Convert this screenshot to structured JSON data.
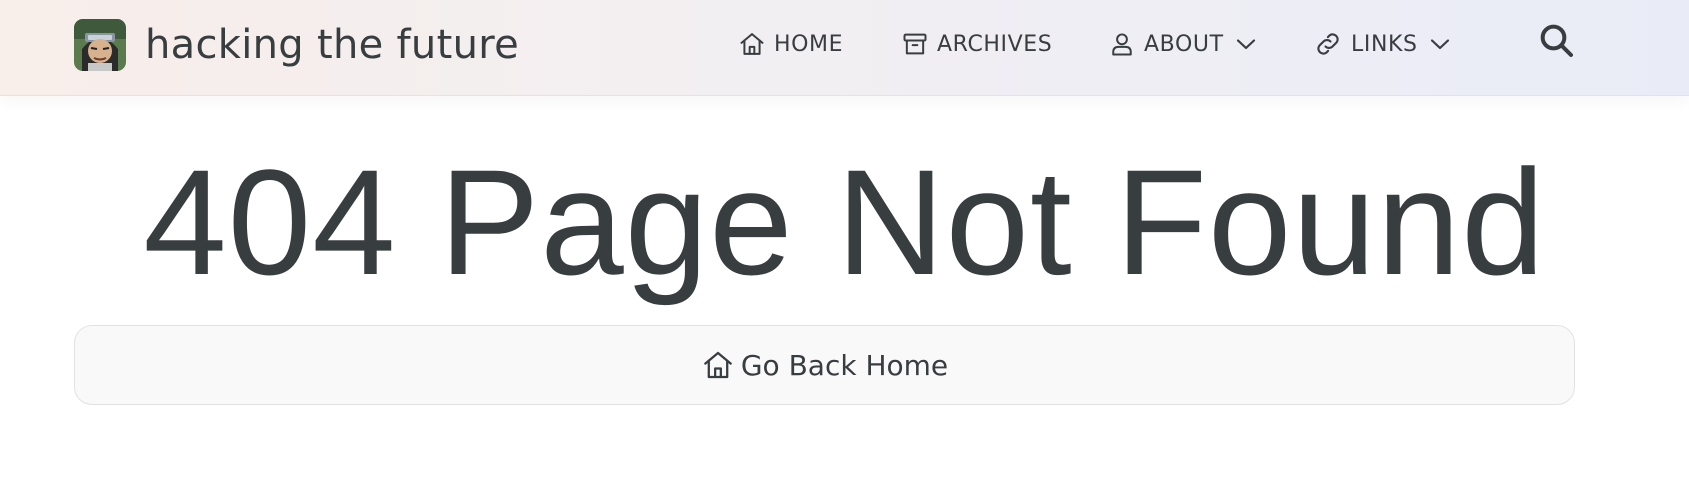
{
  "header": {
    "site_title": "hacking the future",
    "avatar_icon": "anime-avatar-icon",
    "nav": [
      {
        "label": "HOME",
        "icon": "home-icon"
      },
      {
        "label": "ARCHIVES",
        "icon": "archive-icon"
      },
      {
        "label": "ABOUT",
        "icon": "user-icon",
        "has_dropdown": true
      },
      {
        "label": "LINKS",
        "icon": "link-icon",
        "has_dropdown": true
      }
    ],
    "search_icon": "search-icon"
  },
  "main": {
    "headline": "404 Page Not Found",
    "back_button_label": "Go Back Home",
    "back_button_icon": "home-icon"
  },
  "colors": {
    "text": "#383d40",
    "header_gradient_start": "#f8eeea",
    "header_gradient_end": "#e9ecf7",
    "button_background": "#f9f9f9",
    "button_border": "#e2e2e2"
  }
}
